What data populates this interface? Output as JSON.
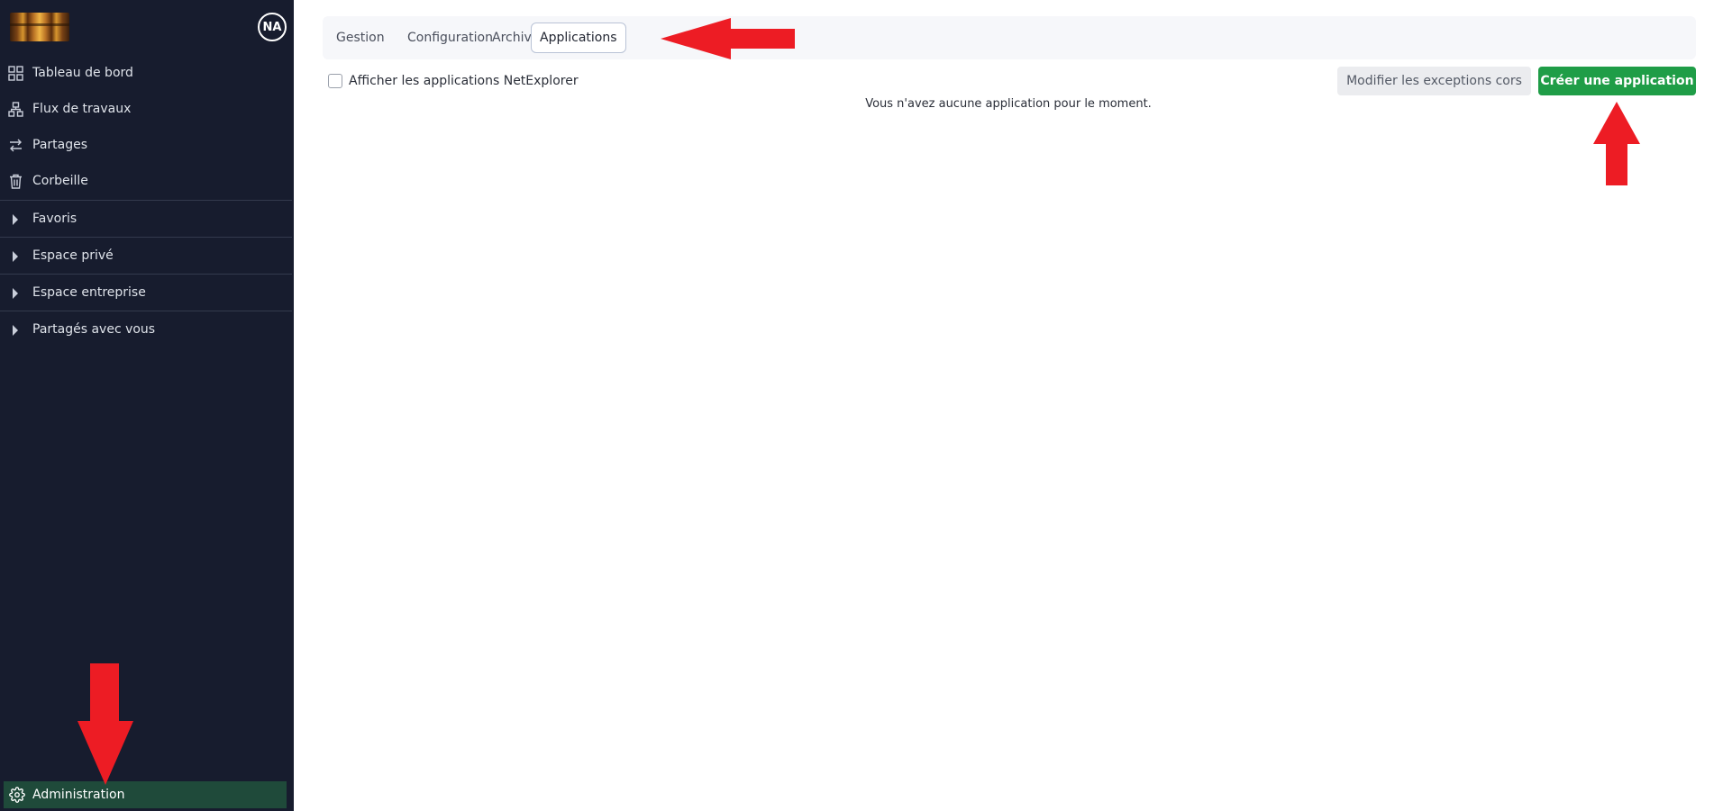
{
  "sidebar": {
    "avatar_initials": "NA",
    "nav": [
      {
        "label": "Tableau de bord",
        "icon": "dashboard-grid-icon"
      },
      {
        "label": "Flux de travaux",
        "icon": "workflow-icon"
      },
      {
        "label": "Partages",
        "icon": "share-arrows-icon"
      },
      {
        "label": "Corbeille",
        "icon": "trash-icon"
      }
    ],
    "tree": [
      {
        "label": "Favoris"
      },
      {
        "label": "Espace privé"
      },
      {
        "label": "Espace entreprise"
      },
      {
        "label": "Partagés avec vous"
      }
    ],
    "admin_label": "Administration"
  },
  "tabs": [
    {
      "label": "Gestion",
      "active": false
    },
    {
      "label": "Configuration",
      "active": false
    },
    {
      "label": "Archives",
      "active": false
    },
    {
      "label": "Applications",
      "active": true
    }
  ],
  "toolbar": {
    "checkbox_label": "Afficher les applications NetExplorer",
    "checkbox_checked": false,
    "cors_button": "Modifier les exceptions cors",
    "create_button": "Créer une application"
  },
  "empty_message": "Vous n'avez aucune application pour le moment.",
  "colors": {
    "sidebar_bg": "#171c2e",
    "admin_active_bg": "#1f4a3a",
    "create_button_bg": "#1f9d47",
    "annotation_arrow": "#ed1c24"
  }
}
